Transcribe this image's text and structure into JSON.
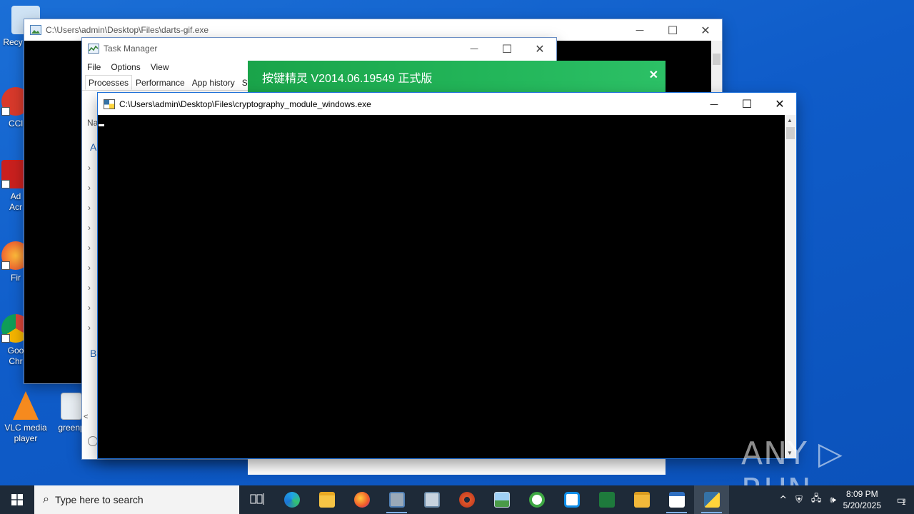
{
  "desktop": {
    "icons": [
      {
        "name": "recycle-bin",
        "label": "Recy"
      },
      {
        "name": "ccleaner",
        "label": "CCl"
      },
      {
        "name": "adobe-acrobat",
        "label_line1": "Ad",
        "label_line2": "Acr"
      },
      {
        "name": "firefox",
        "label": "Fir"
      },
      {
        "name": "google-chrome",
        "label_line1": "Goo",
        "label_line2": "Chr"
      },
      {
        "name": "vlc",
        "label_line1": "VLC media",
        "label_line2": "player"
      },
      {
        "name": "greenp",
        "label": "greenp"
      }
    ]
  },
  "darts_window": {
    "title": "C:\\Users\\admin\\Desktop\\Files\\darts-gif.exe",
    "minimize": "—",
    "maximize": "☐",
    "close": "✕"
  },
  "task_manager": {
    "title": "Task Manager",
    "menu": [
      "File",
      "Options",
      "View"
    ],
    "tabs": [
      "Processes",
      "Performance",
      "App history",
      "St"
    ],
    "column_header": "Na",
    "group_apps": "A",
    "group_background": "B",
    "chevron": "›",
    "hscroll_left": "<",
    "minimize": "—",
    "maximize": "☐",
    "close": "✕"
  },
  "toast": {
    "title": "按键精灵 V2014.06.19549 正式版",
    "close": "✕",
    "accent": "#1fae52"
  },
  "console_window": {
    "title": "C:\\Users\\admin\\Desktop\\Files\\cryptography_module_windows.exe",
    "minimize": "—",
    "maximize": "☐",
    "close": "✕"
  },
  "watermark": "ANY ▷ RUN",
  "taskbar": {
    "search_placeholder": "Type here to search",
    "time": "8:09 PM",
    "date": "5/20/2025",
    "notification_count": "1",
    "apps": [
      "task-view",
      "edge",
      "file-explorer",
      "firefox",
      "app-installer",
      "printer-tool",
      "settings-gear",
      "photos",
      "qbittorrent",
      "teamviewer",
      "excel",
      "folder",
      "news-window",
      "python-console"
    ]
  }
}
